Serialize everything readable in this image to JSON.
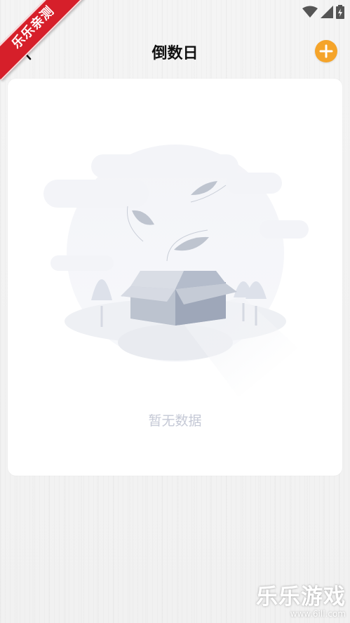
{
  "status_bar": {
    "icons": [
      "wifi-icon",
      "cellular-signal-icon",
      "battery-icon"
    ]
  },
  "header": {
    "title": "倒数日",
    "back_icon": "chevron-left-icon",
    "add_icon": "plus-icon",
    "accent_color": "#f5a42a"
  },
  "card": {
    "empty_state_text": "暂无数据",
    "illustration": "empty-box-icon"
  },
  "watermarks": {
    "ribbon_text": "乐乐亲测",
    "brand_text": "乐乐游戏",
    "brand_url": "www.6ill.com"
  }
}
